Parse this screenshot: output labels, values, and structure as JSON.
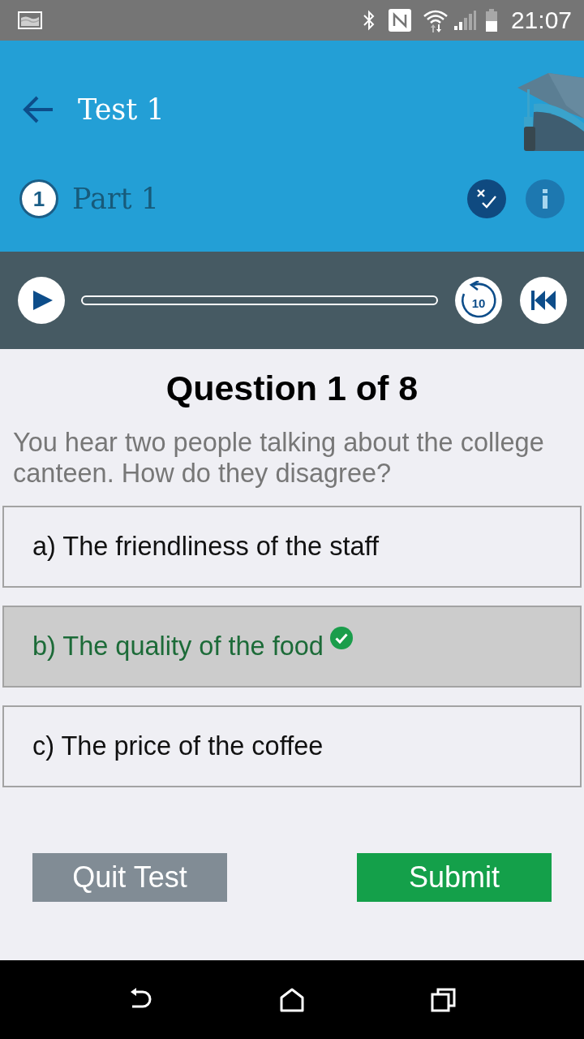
{
  "status_bar": {
    "time": "21:07"
  },
  "header": {
    "title": "Test 1",
    "part": {
      "number": "1",
      "label": "Part 1"
    }
  },
  "player": {
    "level": 0,
    "replay_label": "10"
  },
  "question": {
    "heading": "Question 1 of 8",
    "prompt": "You hear two people talking about the college canteen. How do they disagree?",
    "options": [
      {
        "label": "a) The friendliness of the staff",
        "selected": false,
        "correct": false
      },
      {
        "label": "b) The quality of the food",
        "selected": true,
        "correct": true
      },
      {
        "label": "c) The price of the coffee",
        "selected": false,
        "correct": false
      }
    ]
  },
  "buttons": [
    {
      "label": "Quit Test",
      "kind": "secondary"
    },
    {
      "label": "Submit",
      "kind": "primary"
    }
  ]
}
